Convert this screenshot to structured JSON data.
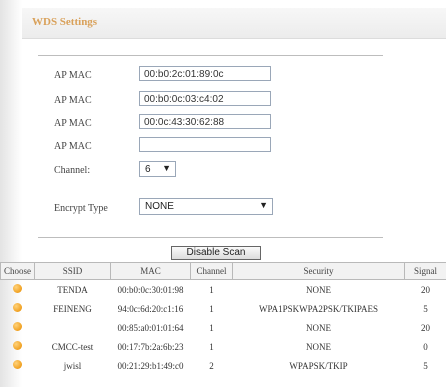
{
  "header": {
    "title": "WDS Settings"
  },
  "form": {
    "ap_mac_label": "AP MAC",
    "ap_mac_values": [
      "00:b0:2c:01:89:0c",
      "00:b0:0c:03:c4:02",
      "00:0c:43:30:62:88",
      ""
    ],
    "channel_label": "Channel:",
    "channel_value": "6",
    "encrypt_label": "Encrypt Type",
    "encrypt_value": "NONE"
  },
  "scan_button": {
    "label": "Disable Scan"
  },
  "table": {
    "headers": [
      "Choose",
      "SSID",
      "MAC",
      "Channel",
      "Security",
      "Signal"
    ],
    "rows": [
      {
        "ssid": "TENDA",
        "mac": "00:b0:0c:30:01:98",
        "channel": "1",
        "security": "NONE",
        "signal": "20"
      },
      {
        "ssid": "FEINENG",
        "mac": "94:0c:6d:20:c1:16",
        "channel": "1",
        "security": "WPA1PSKWPA2PSK/TKIPAES",
        "signal": "5"
      },
      {
        "ssid": "",
        "mac": "00:85:a0:01:01:64",
        "channel": "1",
        "security": "NONE",
        "signal": "20"
      },
      {
        "ssid": "CMCC-test",
        "mac": "00:17:7b:2a:6b:23",
        "channel": "1",
        "security": "NONE",
        "signal": "0"
      },
      {
        "ssid": "jwisl",
        "mac": "00:21:29:b1:49:c0",
        "channel": "2",
        "security": "WPAPSK/TKIP",
        "signal": "5"
      }
    ]
  }
}
